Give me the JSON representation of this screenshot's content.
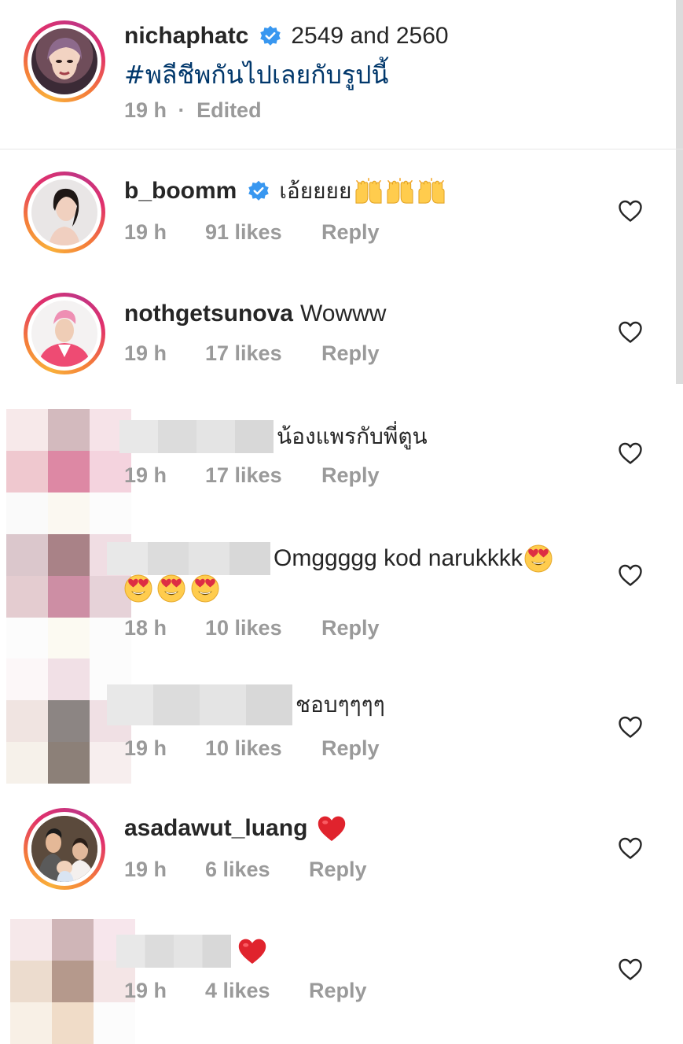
{
  "colors": {
    "hashtag": "#00376b",
    "verified": "#3897f0",
    "meta_text": "#9a9a9a",
    "heart_red": "#e0232d"
  },
  "caption": {
    "username": "nichaphatc",
    "verified": true,
    "text": "2549 and 2560",
    "hashtag": "#พลีชีพกันไปเลยกับรูปนี้",
    "timestamp": "19 h",
    "separator": "·",
    "edited": "Edited"
  },
  "comments": [
    {
      "username": "b_boomm",
      "verified": true,
      "text": "เอ้ยยยย",
      "emoji": "raised-hands x3",
      "time": "19 h",
      "likes": "91 likes",
      "reply": "Reply"
    },
    {
      "username": "nothgetsunova",
      "verified": false,
      "text": "Wowww",
      "time": "19 h",
      "likes": "17 likes",
      "reply": "Reply"
    },
    {
      "username": "",
      "obscured": true,
      "text": "น้องแพรกับพี่ตูน",
      "time": "19 h",
      "likes": "17 likes",
      "reply": "Reply"
    },
    {
      "username": "",
      "obscured": true,
      "text": "Omggggg kod narukkkk",
      "emoji": "heart-eyes x4",
      "time": "18 h",
      "likes": "10 likes",
      "reply": "Reply"
    },
    {
      "username": "",
      "obscured": true,
      "text": "ชอบๆๆๆๆ",
      "time": "19 h",
      "likes": "10 likes",
      "reply": "Reply"
    },
    {
      "username": "asadawut_luang",
      "verified": false,
      "text": "",
      "emoji": "red-heart",
      "time": "19 h",
      "likes": "6 likes",
      "reply": "Reply"
    },
    {
      "username": "",
      "obscured": true,
      "text": "",
      "emoji": "red-heart",
      "time": "19 h",
      "likes": "4 likes",
      "reply": "Reply"
    }
  ],
  "icons": {
    "like": "heart-outline-icon",
    "verified": "verified-badge-icon"
  }
}
